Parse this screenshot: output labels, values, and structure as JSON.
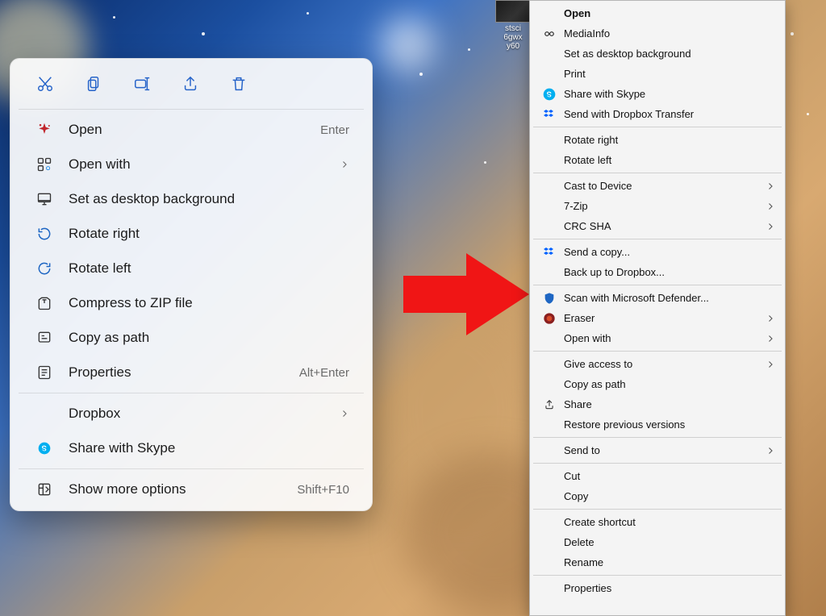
{
  "desktop_icon": {
    "line1": "stsci",
    "line2": "6gwx",
    "line3": "y60"
  },
  "menu11": {
    "toolbar": [
      "cut",
      "copy",
      "rename",
      "share",
      "delete"
    ],
    "items": [
      {
        "label": "Open",
        "hint": "Enter",
        "icon": "sparkle"
      },
      {
        "label": "Open with",
        "submenu": true,
        "icon": "openwith"
      },
      {
        "label": "Set as desktop background",
        "icon": "desktop"
      },
      {
        "label": "Rotate right",
        "icon": "rotate-right"
      },
      {
        "label": "Rotate left",
        "icon": "rotate-left"
      },
      {
        "label": "Compress to ZIP file",
        "icon": "zip"
      },
      {
        "label": "Copy as path",
        "icon": "path"
      },
      {
        "label": "Properties",
        "hint": "Alt+Enter",
        "icon": "properties"
      }
    ],
    "extra": [
      {
        "label": "Dropbox",
        "submenu": true
      },
      {
        "label": "Share with Skype",
        "icon": "skype"
      }
    ],
    "more": {
      "label": "Show more options",
      "hint": "Shift+F10",
      "icon": "more"
    }
  },
  "menu10": {
    "groups": [
      [
        {
          "label": "Open",
          "bold": true
        },
        {
          "label": "MediaInfo",
          "icon": "mediainfo"
        },
        {
          "label": "Set as desktop background"
        },
        {
          "label": "Print"
        },
        {
          "label": "Share with Skype",
          "icon": "skype"
        },
        {
          "label": "Send with Dropbox Transfer",
          "icon": "dropbox"
        }
      ],
      [
        {
          "label": "Rotate right"
        },
        {
          "label": "Rotate left"
        }
      ],
      [
        {
          "label": "Cast to Device",
          "submenu": true
        },
        {
          "label": "7-Zip",
          "submenu": true
        },
        {
          "label": "CRC SHA",
          "submenu": true
        }
      ],
      [
        {
          "label": "Send a copy...",
          "icon": "dropbox"
        },
        {
          "label": "Back up to Dropbox..."
        }
      ],
      [
        {
          "label": "Scan with Microsoft Defender...",
          "icon": "defender"
        },
        {
          "label": "Eraser",
          "icon": "eraser",
          "submenu": true
        },
        {
          "label": "Open with",
          "submenu": true
        }
      ],
      [
        {
          "label": "Give access to",
          "submenu": true
        },
        {
          "label": "Copy as path"
        },
        {
          "label": "Share",
          "icon": "share"
        },
        {
          "label": "Restore previous versions"
        }
      ],
      [
        {
          "label": "Send to",
          "submenu": true
        }
      ],
      [
        {
          "label": "Cut"
        },
        {
          "label": "Copy"
        }
      ],
      [
        {
          "label": "Create shortcut"
        },
        {
          "label": "Delete"
        },
        {
          "label": "Rename"
        }
      ],
      [
        {
          "label": "Properties"
        }
      ]
    ]
  }
}
